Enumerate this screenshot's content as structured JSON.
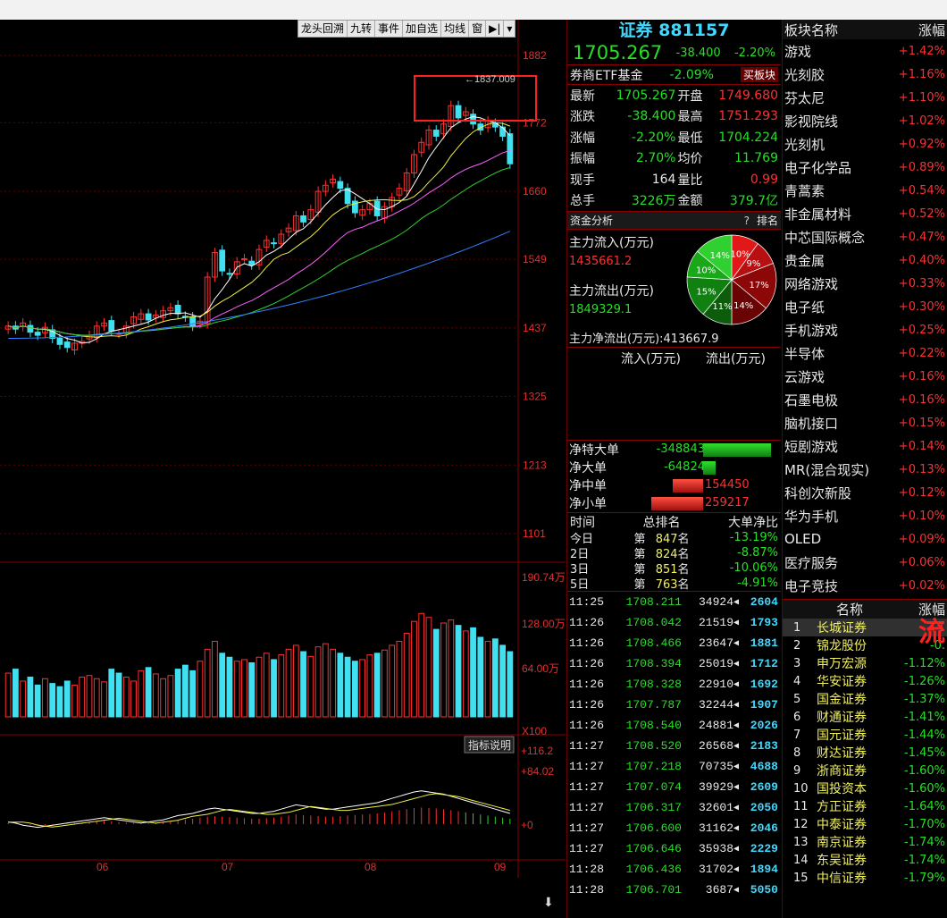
{
  "toolbar": {
    "items": [
      "龙头回溯",
      "九转",
      "事件",
      "加自选",
      "均线",
      "窗",
      "▶|",
      "▾"
    ]
  },
  "price_axis": [
    "1882",
    "1772",
    "1660",
    "1549",
    "1437",
    "1325",
    "1213",
    "1101"
  ],
  "volume_axis": [
    "190.74万",
    "128.00万",
    "64.00万",
    "X100"
  ],
  "macd_axis": [
    "+116.2",
    "+84.02",
    "+0"
  ],
  "month_labels": [
    "06",
    "07",
    "08",
    "09"
  ],
  "peak_label": "1837.009",
  "indicator_btn": "指标说明",
  "header": {
    "name": "证券 881157",
    "price": "1705.267",
    "change": "-38.400",
    "pct": "-2.20%",
    "etf_label": "券商ETF基金",
    "etf_pct": "-2.09%",
    "buy_btn": "买板块"
  },
  "quote": [
    {
      "l1": "最新",
      "v1": "1705.267",
      "l2": "开盘",
      "v2": "1749.680"
    },
    {
      "l1": "涨跌",
      "v1": "-38.400",
      "l2": "最高",
      "v2": "1751.293"
    },
    {
      "l1": "涨幅",
      "v1": "-2.20%",
      "l2": "最低",
      "v2": "1704.224"
    },
    {
      "l1": "振幅",
      "v1": "2.70%",
      "l2": "均价",
      "v2": "11.769"
    },
    {
      "l1": "现手",
      "v1": "164",
      "l2": "量比",
      "v2": "0.99"
    },
    {
      "l1": "总手",
      "v1": "3226万",
      "l2": "金额",
      "v2": "379.7亿"
    }
  ],
  "fund": {
    "title": "资金分析",
    "rank_btn": "排名",
    "help": "?",
    "in_label": "主力流入(万元)",
    "in_val": "1435661.2",
    "out_label": "主力流出(万元)",
    "out_val": "1849329.1",
    "net_label": "主力净流出(万元):",
    "net_val": "413667.9",
    "pie": [
      {
        "label": "10%",
        "value": 10,
        "color": "#e01818"
      },
      {
        "label": "9%",
        "value": 9,
        "color": "#b81010"
      },
      {
        "label": "17%",
        "value": 17,
        "color": "#8c0808"
      },
      {
        "label": "14%",
        "value": 14,
        "color": "#6a0404"
      },
      {
        "label": "11%",
        "value": 11,
        "color": "#0c5c0c"
      },
      {
        "label": "15%",
        "value": 15,
        "color": "#108010"
      },
      {
        "label": "10%",
        "value": 10,
        "color": "#18a818"
      },
      {
        "label": "14%",
        "value": 14,
        "color": "#30d030"
      }
    ]
  },
  "flow_header": {
    "in": "流入(万元)",
    "out": "流出(万元)"
  },
  "net_orders": [
    {
      "label": "净特大单",
      "value": "-348843",
      "bar": 0.95,
      "color": "#20c020"
    },
    {
      "label": "净大单",
      "value": "-64824",
      "bar": 0.18,
      "color": "#20c020"
    },
    {
      "label": "净中单",
      "value": "154450",
      "bar": 0.42,
      "color": "#e03020"
    },
    {
      "label": "净小单",
      "value": "259217",
      "bar": 0.72,
      "color": "#e03020"
    }
  ],
  "rank_header": {
    "c1": "时间",
    "c2": "总排名",
    "c3": "大单净比"
  },
  "ranks": [
    {
      "t": "今日",
      "p": "第",
      "n": "847",
      "s": "名",
      "v": "-13.19%"
    },
    {
      "t": "2日",
      "p": "第",
      "n": "824",
      "s": "名",
      "v": "-8.87%"
    },
    {
      "t": "3日",
      "p": "第",
      "n": "851",
      "s": "名",
      "v": "-10.06%"
    },
    {
      "t": "5日",
      "p": "第",
      "n": "763",
      "s": "名",
      "v": "-4.91%"
    }
  ],
  "ticks": [
    {
      "t": "11:25",
      "p": "1708.211",
      "v": "34924",
      "n": "2604"
    },
    {
      "t": "11:26",
      "p": "1708.042",
      "v": "21519",
      "n": "1793"
    },
    {
      "t": "11:26",
      "p": "1708.466",
      "v": "23647",
      "n": "1881"
    },
    {
      "t": "11:26",
      "p": "1708.394",
      "v": "25019",
      "n": "1712"
    },
    {
      "t": "11:26",
      "p": "1708.328",
      "v": "22910",
      "n": "1692"
    },
    {
      "t": "11:26",
      "p": "1707.787",
      "v": "32244",
      "n": "1907"
    },
    {
      "t": "11:26",
      "p": "1708.540",
      "v": "24881",
      "n": "2026"
    },
    {
      "t": "11:27",
      "p": "1708.520",
      "v": "26568",
      "n": "2183"
    },
    {
      "t": "11:27",
      "p": "1707.218",
      "v": "70735",
      "n": "4688"
    },
    {
      "t": "11:27",
      "p": "1707.074",
      "v": "39929",
      "n": "2609"
    },
    {
      "t": "11:27",
      "p": "1706.317",
      "v": "32601",
      "n": "2050"
    },
    {
      "t": "11:27",
      "p": "1706.600",
      "v": "31162",
      "n": "2046"
    },
    {
      "t": "11:27",
      "p": "1706.646",
      "v": "35938",
      "n": "2229"
    },
    {
      "t": "11:28",
      "p": "1706.436",
      "v": "31702",
      "n": "1894"
    },
    {
      "t": "11:28",
      "p": "1706.701",
      "v": "3687",
      "n": "5050"
    }
  ],
  "sector_header": {
    "name": "板块名称",
    "chg": "涨幅"
  },
  "sectors": [
    {
      "n": "游戏",
      "c": "+1.42%"
    },
    {
      "n": "光刻胶",
      "c": "+1.16%"
    },
    {
      "n": "芬太尼",
      "c": "+1.10%"
    },
    {
      "n": "影视院线",
      "c": "+1.02%"
    },
    {
      "n": "光刻机",
      "c": "+0.92%"
    },
    {
      "n": "电子化学品",
      "c": "+0.89%"
    },
    {
      "n": "青蒿素",
      "c": "+0.54%"
    },
    {
      "n": "非金属材料",
      "c": "+0.52%"
    },
    {
      "n": "中芯国际概念",
      "c": "+0.47%"
    },
    {
      "n": "贵金属",
      "c": "+0.40%"
    },
    {
      "n": "网络游戏",
      "c": "+0.33%"
    },
    {
      "n": "电子纸",
      "c": "+0.30%"
    },
    {
      "n": "手机游戏",
      "c": "+0.25%"
    },
    {
      "n": "半导体",
      "c": "+0.22%"
    },
    {
      "n": "云游戏",
      "c": "+0.16%"
    },
    {
      "n": "石墨电极",
      "c": "+0.16%"
    },
    {
      "n": "脑机接口",
      "c": "+0.15%"
    },
    {
      "n": "短剧游戏",
      "c": "+0.14%"
    },
    {
      "n": "MR(混合现实)",
      "c": "+0.13%"
    },
    {
      "n": "科创次新股",
      "c": "+0.12%"
    },
    {
      "n": "华为手机",
      "c": "+0.10%"
    },
    {
      "n": "OLED",
      "c": "+0.09%"
    },
    {
      "n": "医疗服务",
      "c": "+0.06%"
    },
    {
      "n": "电子竞技",
      "c": "+0.02%"
    }
  ],
  "stock_header": {
    "name": "名称",
    "chg": "涨幅"
  },
  "stocks": [
    {
      "i": "1",
      "n": "长城证券",
      "c": "+1"
    },
    {
      "i": "2",
      "n": "锦龙股份",
      "c": "-0."
    },
    {
      "i": "3",
      "n": "申万宏源",
      "c": "-1.12%"
    },
    {
      "i": "4",
      "n": "华安证券",
      "c": "-1.26%"
    },
    {
      "i": "5",
      "n": "国金证券",
      "c": "-1.37%"
    },
    {
      "i": "6",
      "n": "财通证券",
      "c": "-1.41%"
    },
    {
      "i": "7",
      "n": "国元证券",
      "c": "-1.44%"
    },
    {
      "i": "8",
      "n": "财达证券",
      "c": "-1.45%"
    },
    {
      "i": "9",
      "n": "浙商证券",
      "c": "-1.60%"
    },
    {
      "i": "10",
      "n": "国投资本",
      "c": "-1.60%"
    },
    {
      "i": "11",
      "n": "方正证券",
      "c": "-1.64%"
    },
    {
      "i": "12",
      "n": "中泰证券",
      "c": "-1.70%"
    },
    {
      "i": "13",
      "n": "南京证券",
      "c": "-1.74%"
    },
    {
      "i": "14",
      "n": "东吴证券",
      "c": "-1.74%"
    },
    {
      "i": "15",
      "n": "中信证券",
      "c": "-1.79%"
    }
  ],
  "stream_badge": "流",
  "chart_data": {
    "type": "candlestick",
    "months": [
      "06",
      "07",
      "08",
      "09"
    ],
    "ylim": [
      1101,
      1882
    ],
    "peak": 1837.009,
    "closes": [
      1440,
      1435,
      1445,
      1430,
      1425,
      1438,
      1420,
      1410,
      1405,
      1412,
      1415,
      1425,
      1440,
      1445,
      1432,
      1428,
      1440,
      1455,
      1460,
      1450,
      1458,
      1465,
      1470,
      1460,
      1455,
      1440,
      1448,
      1520,
      1560,
      1530,
      1525,
      1545,
      1550,
      1540,
      1565,
      1580,
      1575,
      1590,
      1600,
      1620,
      1610,
      1630,
      1660,
      1670,
      1680,
      1665,
      1640,
      1625,
      1630,
      1640,
      1620,
      1635,
      1650,
      1665,
      1690,
      1720,
      1740,
      1760,
      1750,
      1770,
      1800,
      1780,
      1790,
      1770,
      1760,
      1775,
      1765,
      1750,
      1705
    ],
    "volumes": [
      55,
      60,
      45,
      50,
      40,
      48,
      42,
      38,
      45,
      40,
      50,
      52,
      48,
      44,
      60,
      55,
      50,
      45,
      58,
      62,
      54,
      48,
      52,
      60,
      65,
      58,
      70,
      85,
      95,
      80,
      75,
      70,
      72,
      68,
      75,
      80,
      72,
      78,
      85,
      90,
      82,
      76,
      88,
      92,
      85,
      80,
      75,
      70,
      72,
      78,
      80,
      84,
      90,
      95,
      105,
      120,
      130,
      125,
      110,
      118,
      122,
      115,
      108,
      112,
      100,
      95,
      98,
      90,
      82
    ],
    "macd": [
      2,
      1,
      -1,
      -2,
      -3,
      -2,
      -1,
      0,
      1,
      2,
      3,
      4,
      5,
      6,
      5,
      4,
      3,
      2,
      1,
      2,
      3,
      4,
      6,
      8,
      9,
      10,
      12,
      14,
      15,
      14,
      13,
      12,
      11,
      10,
      10,
      11,
      12,
      14,
      16,
      18,
      17,
      16,
      15,
      14,
      14,
      15,
      16,
      17,
      18,
      19,
      20,
      22,
      24,
      26,
      28,
      30,
      31,
      30,
      29,
      28,
      26,
      24,
      22,
      20,
      18,
      16,
      14,
      12,
      10
    ]
  }
}
